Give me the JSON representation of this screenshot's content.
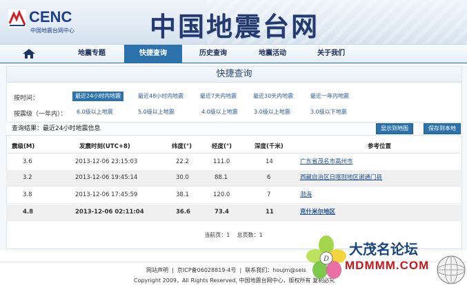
{
  "header": {
    "logo_text": "CENC",
    "logo_sub": "中国地震台网中心",
    "site_title": "中国地震台网"
  },
  "nav": {
    "items": [
      {
        "label": "地震专题"
      },
      {
        "label": "快捷查询",
        "active": true
      },
      {
        "label": "历史查询"
      },
      {
        "label": "地震活动"
      },
      {
        "label": "关于我们"
      }
    ]
  },
  "query": {
    "title": "快捷查询",
    "time_label": "按时间：",
    "time_filters": [
      "最近24小时内地震",
      "最近48小时内地震",
      "最近7天内地震",
      "最近30天内地震",
      "最近一年内地震"
    ],
    "mag_label": "按震级（一年内）：",
    "mag_filters": [
      "6.0级以上地震",
      "5.0级以上地震",
      "4.0级以上地震",
      "3.0级以上地震",
      "3.0级以下地震"
    ]
  },
  "result": {
    "text": "查询结果：最近24小时地震信息",
    "map_button": "显示到地图",
    "save_button": "保存到本地"
  },
  "table": {
    "headers": [
      "震级(M)",
      "发震时刻(UTC+8)",
      "纬度(°)",
      "经度(°)",
      "深度(千米)",
      "参考位置"
    ],
    "rows": [
      {
        "mag": "3.6",
        "time": "2013-12-06 23:15:03",
        "lat": "22.2",
        "lon": "111.0",
        "depth": "14",
        "place": "广东省茂名市高州市"
      },
      {
        "mag": "3.2",
        "time": "2013-12-06 19:45:14",
        "lat": "30.0",
        "lon": "88.1",
        "depth": "6",
        "place": "西藏自治区日喀则地区谢通门县"
      },
      {
        "mag": "3.8",
        "time": "2013-12-06 17:45:59",
        "lat": "38.1",
        "lon": "120.0",
        "depth": "7",
        "place": "渤海"
      },
      {
        "mag": "4.8",
        "time": "2013-12-06 02:11:04",
        "lat": "36.6",
        "lon": "73.4",
        "depth": "11",
        "place": "克什米尔地区"
      }
    ]
  },
  "pager": {
    "current": "当前页：1",
    "total": "总页数：1"
  },
  "footer": {
    "link1": "网站声明",
    "sep": "|",
    "icp": "京ICP备06028819-4号",
    "contact": "联系我们：houjm@seis",
    "copyright": "Copyright 2009，All Rights Reserved, 中国地震台网中心，版权所有  复制必究"
  },
  "watermark": {
    "top": "大茂名论坛",
    "bottom": "MDMMM.COM"
  },
  "colors": {
    "nav_active": "#2c73ad",
    "brand": "#1d3d8f",
    "link": "#1d4f96"
  }
}
